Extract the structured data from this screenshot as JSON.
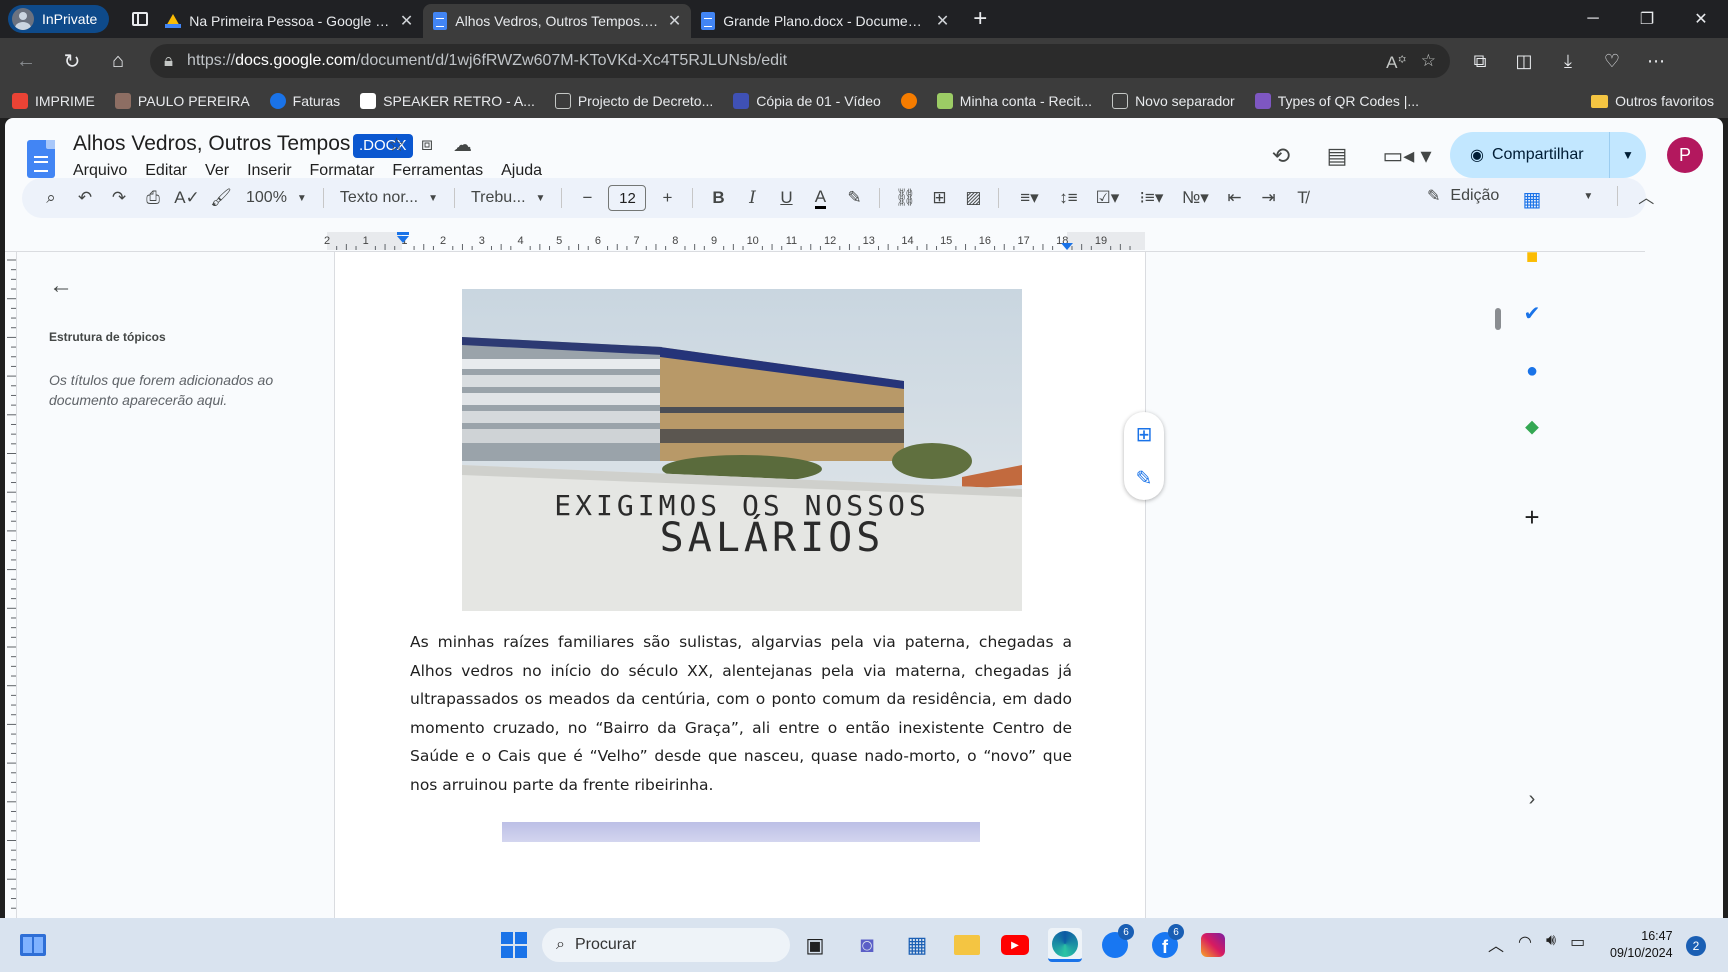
{
  "browser": {
    "inprivate_label": "InPrivate",
    "tabs": [
      {
        "title": "Na Primeira Pessoa - Google Drive",
        "icon": "google-drive-icon",
        "active": false
      },
      {
        "title": "Alhos Vedros, Outros Tempos.docx",
        "icon": "google-docs-icon",
        "active": true
      },
      {
        "title": "Grande Plano.docx - Documentos",
        "icon": "google-docs-icon",
        "active": false
      }
    ],
    "url_prefix": "https://",
    "url_domain": "docs.google.com",
    "url_path": "/document/d/1wj6fRWZw607M-KToVKd-Xc4T5RJLUNsb/edit",
    "bookmarks": [
      {
        "label": "IMPRIME",
        "color": "#ea4335"
      },
      {
        "label": "PAULO PEREIRA",
        "color": "#8d6e63"
      },
      {
        "label": "Faturas",
        "color": "#1a73e8"
      },
      {
        "label": "SPEAKER RETRO - A...",
        "color": "#ffffff"
      },
      {
        "label": "Projecto de Decreto...",
        "color": "#9aa0a6"
      },
      {
        "label": "Cópia de 01 - Vídeo",
        "color": "#3f51b5"
      },
      {
        "label": "",
        "color": "#f57c00"
      },
      {
        "label": "Minha conta - Recit...",
        "color": "#9ccc65"
      },
      {
        "label": "Novo separador",
        "color": "#9aa0a6"
      },
      {
        "label": "Types of QR Codes |...",
        "color": "#7e57c2"
      }
    ],
    "other_favorites": "Outros favoritos"
  },
  "docs": {
    "title": "Alhos Vedros, Outros Tempos",
    "badge": ".DOCX",
    "menu": [
      "Arquivo",
      "Editar",
      "Ver",
      "Inserir",
      "Formatar",
      "Ferramentas",
      "Ajuda"
    ],
    "share_label": "Compartilhar",
    "avatar_letter": "P",
    "toolbar": {
      "zoom": "100%",
      "style": "Texto nor...",
      "font": "Trebu...",
      "font_size": "12",
      "mode": "Edição"
    },
    "ruler_labels": [
      "2",
      "1",
      "1",
      "2",
      "3",
      "4",
      "5",
      "6",
      "7",
      "8",
      "9",
      "10",
      "11",
      "12",
      "13",
      "14",
      "15",
      "16",
      "17",
      "18",
      "19"
    ],
    "outline": {
      "heading": "Estrutura de tópicos",
      "empty_message": "Os títulos que forem adicionados ao documento aparecerão aqui."
    },
    "photo_text": [
      "EXIGIMOS OS NOSSOS",
      "SALÁRIOS"
    ],
    "paragraph": "As minhas raízes familiares são sulistas, algarvias pela via paterna, chegadas a Alhos vedros no início do século XX, alentejanas pela via materna, chegadas já ultrapassados os meados da centúria, com o ponto comum da residência, em dado momento cruzado, no “Bairro da Graça”, ali entre o então inexistente Centro de Saúde e o Cais que é “Velho” desde que nasceu, quase nado-morto, o “novo” que nos arruinou parte da frente ribeirinha."
  },
  "taskbar": {
    "search_placeholder": "Procurar",
    "time": "16:47",
    "date": "09/10/2024",
    "notifications": "2",
    "badges": {
      "messenger": "6",
      "facebook": "6"
    }
  }
}
